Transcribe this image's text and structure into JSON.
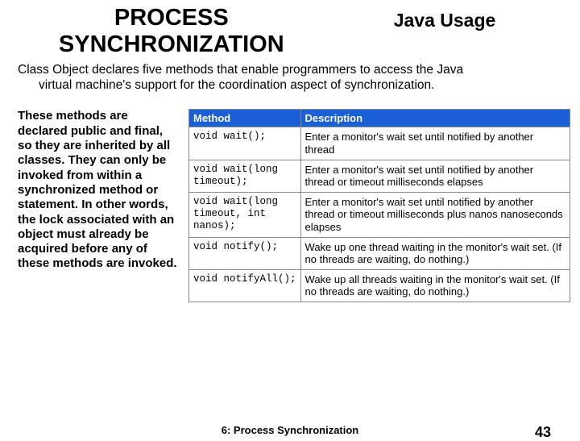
{
  "header": {
    "title_left": "PROCESS SYNCHRONIZATION",
    "title_right": "Java Usage"
  },
  "intro_line1": "Class Object declares five methods that enable programmers to access the Java",
  "intro_line2": "virtual machine's support for the coordination aspect of synchronization.",
  "side_text": "These methods are declared public and final, so they are inherited by all classes. They can only be invoked from within a synchronized method or statement. In other words, the lock associated with an object must already be acquired before any of these methods are invoked.",
  "table": {
    "col_method": "Method",
    "col_desc": "Description",
    "rows": [
      {
        "method": "void wait();",
        "desc": "Enter a monitor's wait set until notified by another thread"
      },
      {
        "method": "void wait(long\ntimeout);",
        "desc": "Enter a monitor's wait set until notified by another thread or timeout milliseconds elapses"
      },
      {
        "method": "void wait(long\ntimeout, int\nnanos);",
        "desc": "Enter a monitor's wait set until notified by another thread or timeout milliseconds plus nanos nanoseconds elapses"
      },
      {
        "method": "void notify();",
        "desc": "Wake up one thread waiting in the monitor's wait set. (If no threads are waiting, do nothing.)"
      },
      {
        "method": "void notifyAll();",
        "desc": "Wake up all threads waiting in the monitor's wait set. (If no threads are waiting, do nothing.)"
      }
    ]
  },
  "footer": {
    "center": "6: Process Synchronization",
    "page": "43"
  }
}
